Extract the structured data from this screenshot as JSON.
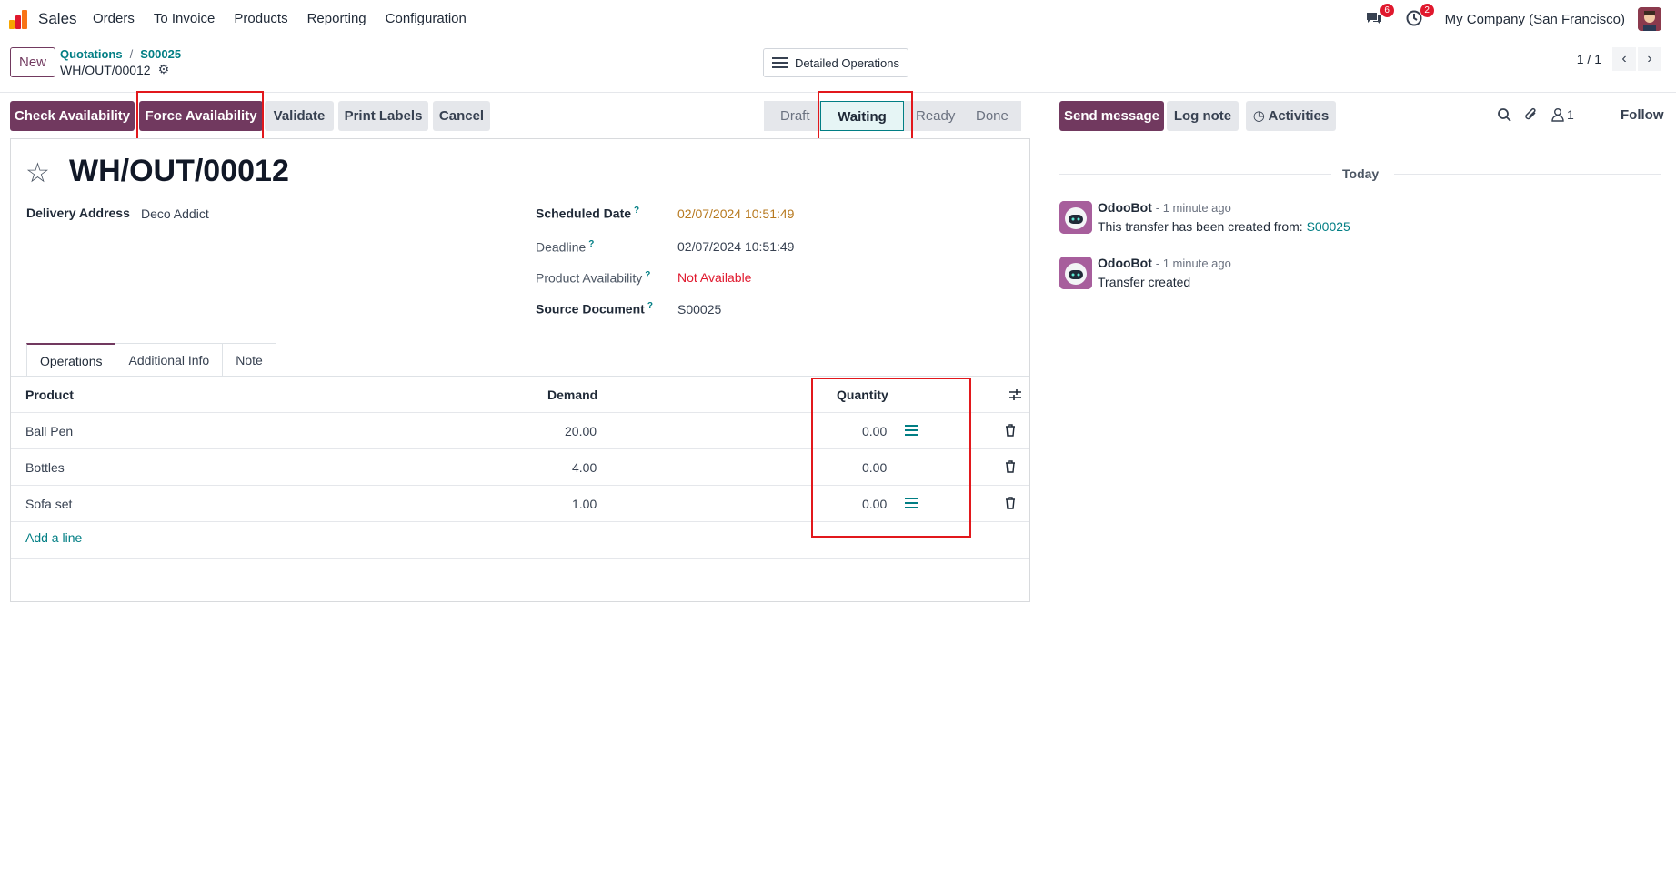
{
  "app": {
    "name": "Sales",
    "menu": [
      "Orders",
      "To Invoice",
      "Products",
      "Reporting",
      "Configuration"
    ],
    "messages_badge": "6",
    "activities_badge": "2",
    "company": "My Company (San Francisco)"
  },
  "control_panel": {
    "new_label": "New",
    "breadcrumb": [
      "Quotations",
      "S00025"
    ],
    "record_name": "WH/OUT/00012",
    "detailed_operations_label": "Detailed Operations",
    "pager": "1 / 1"
  },
  "actions": {
    "check_availability": "Check Availability",
    "force_availability": "Force Availability",
    "validate": "Validate",
    "print_labels": "Print Labels",
    "cancel": "Cancel"
  },
  "statusbar": {
    "stages": [
      "Draft",
      "Waiting",
      "Ready",
      "Done"
    ],
    "current": "Waiting"
  },
  "form": {
    "title": "WH/OUT/00012",
    "delivery_address_label": "Delivery Address",
    "delivery_address_value": "Deco Addict",
    "scheduled_date_label": "Scheduled Date",
    "scheduled_date_value": "02/07/2024 10:51:49",
    "deadline_label": "Deadline",
    "deadline_value": "02/07/2024 10:51:49",
    "product_availability_label": "Product Availability",
    "product_availability_value": "Not Available",
    "source_document_label": "Source Document",
    "source_document_value": "S00025",
    "help_mark": "?"
  },
  "tabs": [
    "Operations",
    "Additional Info",
    "Note"
  ],
  "table": {
    "headers": {
      "product": "Product",
      "demand": "Demand",
      "quantity": "Quantity"
    },
    "rows": [
      {
        "product": "Ball Pen",
        "demand": "20.00",
        "quantity": "0.00",
        "has_details": true
      },
      {
        "product": "Bottles",
        "demand": "4.00",
        "quantity": "0.00",
        "has_details": false
      },
      {
        "product": "Sofa set",
        "demand": "1.00",
        "quantity": "0.00",
        "has_details": true
      }
    ],
    "add_line": "Add a line"
  },
  "chatter": {
    "send_message": "Send message",
    "log_note": "Log note",
    "activities": "Activities",
    "followers_count": "1",
    "follow": "Follow",
    "date_separator": "Today",
    "messages": [
      {
        "author": "OdooBot",
        "time": "- 1 minute ago",
        "body": "This transfer has been created from: ",
        "link": "S00025"
      },
      {
        "author": "OdooBot",
        "time": "- 1 minute ago",
        "body": "Transfer created",
        "link": ""
      }
    ]
  },
  "colors": {
    "primary": "#71395f",
    "link": "#017e84",
    "warning_date": "#b7791f",
    "danger": "#e0182d",
    "highlight": "#e2181c"
  }
}
